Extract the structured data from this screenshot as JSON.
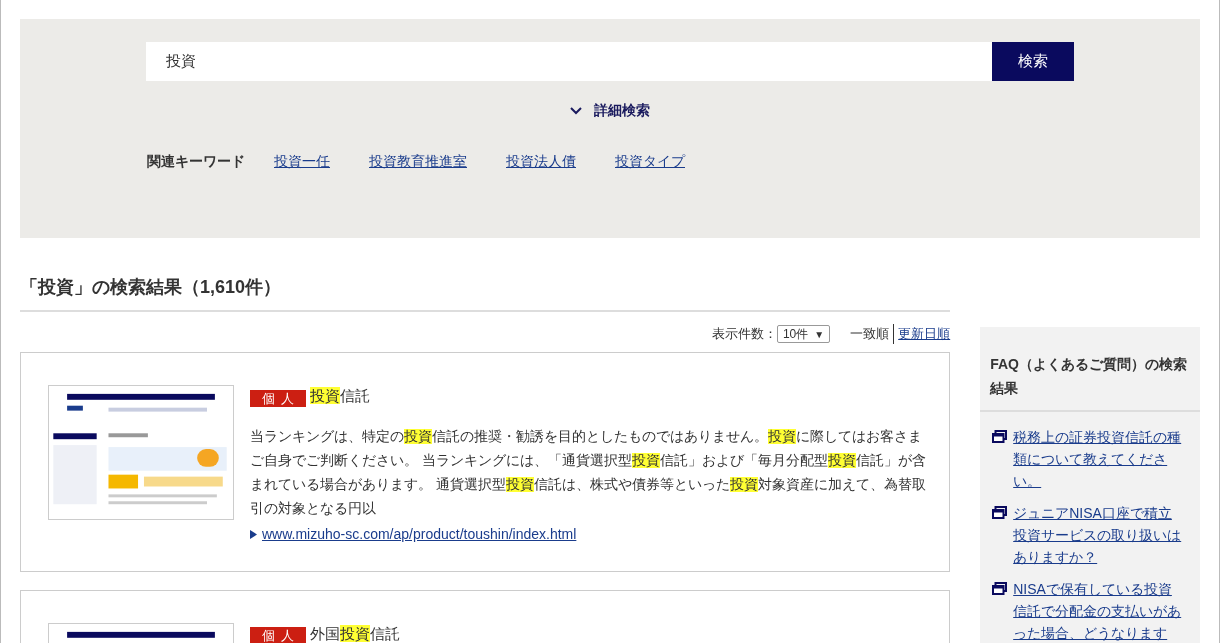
{
  "search": {
    "value": "投資",
    "button": "検索"
  },
  "advanced_search": {
    "label": "詳細検索",
    "expanded": false
  },
  "related_keywords": {
    "label": "関連キーワード",
    "items": [
      "投資一任",
      "投資教育推進室",
      "投資法人債",
      "投資タイプ"
    ]
  },
  "results_heading": "「投資」の検索結果（1,610件）",
  "display_count": {
    "label": "表示件数：",
    "value": "10件",
    "caret": "▼"
  },
  "sort": [
    {
      "label": "一致順",
      "selected": true
    },
    {
      "label": "更新日順",
      "selected": false
    }
  ],
  "results": [
    {
      "badge": "個人",
      "title": [
        {
          "text": "投資",
          "highlight": true
        },
        {
          "text": "信託",
          "highlight": false
        }
      ],
      "snippet": [
        {
          "text": "当ランキングは、特定の",
          "highlight": false
        },
        {
          "text": "投資",
          "highlight": true
        },
        {
          "text": "信託の推奨・勧誘を目的としたものではありません。",
          "highlight": false
        },
        {
          "text": "投資",
          "highlight": true
        },
        {
          "text": "に際してはお客さまご自身でご判断ください。 当ランキングには、「通貨選択型",
          "highlight": false
        },
        {
          "text": "投資",
          "highlight": true
        },
        {
          "text": "信託」および「毎月分配型",
          "highlight": false
        },
        {
          "text": "投資",
          "highlight": true
        },
        {
          "text": "信託」が含まれている場合があります。 通貨選択型",
          "highlight": false
        },
        {
          "text": "投資",
          "highlight": true
        },
        {
          "text": "信託は、株式や債券等といった",
          "highlight": false
        },
        {
          "text": "投資",
          "highlight": true
        },
        {
          "text": "対象資産に加えて、為替取引の対象となる円以",
          "highlight": false
        }
      ],
      "url": "www.mizuho-sc.com/ap/product/toushin/index.html"
    },
    {
      "badge": "個人",
      "title": [
        {
          "text": "外国",
          "highlight": false
        },
        {
          "text": "投資",
          "highlight": true
        },
        {
          "text": "信託",
          "highlight": false
        }
      ]
    }
  ],
  "faq": {
    "title": "FAQ（よくあるご質問）の検索結果",
    "items": [
      "税務上の証券投資信託の種類について教えてください。",
      "ジュニアNISA口座で積立投資サービスの取り扱いはありますか？",
      "NISAで保有している投資信託で分配金の支払いがあった場合、どうなります"
    ]
  }
}
